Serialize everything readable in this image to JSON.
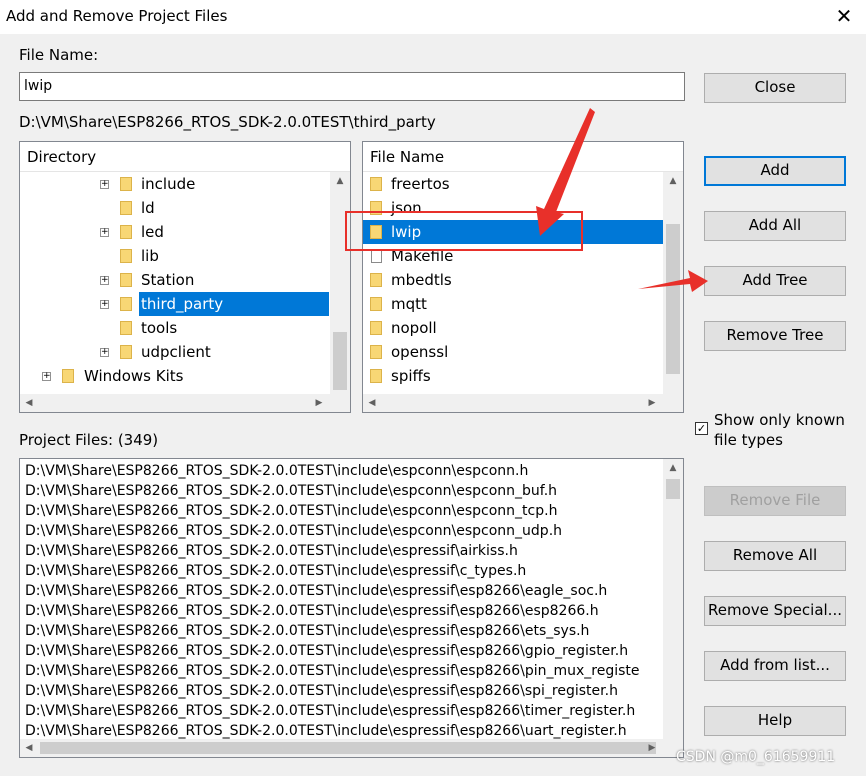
{
  "window": {
    "title": "Add and Remove Project Files",
    "close_glyph": "✕"
  },
  "file_name": {
    "label": "File Name:",
    "value": "lwip"
  },
  "current_path": "D:\\VM\\Share\\ESP8266_RTOS_SDK-2.0.0TEST\\third_party",
  "directory": {
    "header": "Directory",
    "items": [
      {
        "label": "include",
        "expand": "+"
      },
      {
        "label": "ld"
      },
      {
        "label": "led",
        "expand": "+"
      },
      {
        "label": "lib"
      },
      {
        "label": "Station",
        "expand": "+"
      },
      {
        "label": "third_party",
        "expand": "+",
        "selected": true
      },
      {
        "label": "tools"
      },
      {
        "label": "udpclient",
        "expand": "+"
      },
      {
        "label": "Windows Kits",
        "expand": "+"
      }
    ]
  },
  "files": {
    "header": "File Name",
    "items": [
      {
        "label": "freertos",
        "kind": "folder"
      },
      {
        "label": "json",
        "kind": "folder"
      },
      {
        "label": "lwip",
        "kind": "folder",
        "selected": true
      },
      {
        "label": "Makefile",
        "kind": "file"
      },
      {
        "label": "mbedtls",
        "kind": "folder"
      },
      {
        "label": "mqtt",
        "kind": "folder"
      },
      {
        "label": "nopoll",
        "kind": "folder"
      },
      {
        "label": "openssl",
        "kind": "folder"
      },
      {
        "label": "spiffs",
        "kind": "folder"
      }
    ]
  },
  "buttons": {
    "close": "Close",
    "add": "Add",
    "add_all": "Add All",
    "add_tree": "Add Tree",
    "remove_tree": "Remove Tree",
    "remove_file": "Remove File",
    "remove_all": "Remove All",
    "remove_special": "Remove Special...",
    "add_from_list": "Add from list...",
    "help": "Help"
  },
  "show_known": {
    "line1": "Show only known",
    "line2": "file types",
    "checked": true,
    "check_glyph": "✓"
  },
  "project_files": {
    "label": "Project Files: (349)",
    "items": [
      "D:\\VM\\Share\\ESP8266_RTOS_SDK-2.0.0TEST\\include\\espconn\\espconn.h",
      "D:\\VM\\Share\\ESP8266_RTOS_SDK-2.0.0TEST\\include\\espconn\\espconn_buf.h",
      "D:\\VM\\Share\\ESP8266_RTOS_SDK-2.0.0TEST\\include\\espconn\\espconn_tcp.h",
      "D:\\VM\\Share\\ESP8266_RTOS_SDK-2.0.0TEST\\include\\espconn\\espconn_udp.h",
      "D:\\VM\\Share\\ESP8266_RTOS_SDK-2.0.0TEST\\include\\espressif\\airkiss.h",
      "D:\\VM\\Share\\ESP8266_RTOS_SDK-2.0.0TEST\\include\\espressif\\c_types.h",
      "D:\\VM\\Share\\ESP8266_RTOS_SDK-2.0.0TEST\\include\\espressif\\esp8266\\eagle_soc.h",
      "D:\\VM\\Share\\ESP8266_RTOS_SDK-2.0.0TEST\\include\\espressif\\esp8266\\esp8266.h",
      "D:\\VM\\Share\\ESP8266_RTOS_SDK-2.0.0TEST\\include\\espressif\\esp8266\\ets_sys.h",
      "D:\\VM\\Share\\ESP8266_RTOS_SDK-2.0.0TEST\\include\\espressif\\esp8266\\gpio_register.h",
      "D:\\VM\\Share\\ESP8266_RTOS_SDK-2.0.0TEST\\include\\espressif\\esp8266\\pin_mux_registe",
      "D:\\VM\\Share\\ESP8266_RTOS_SDK-2.0.0TEST\\include\\espressif\\esp8266\\spi_register.h",
      "D:\\VM\\Share\\ESP8266_RTOS_SDK-2.0.0TEST\\include\\espressif\\esp8266\\timer_register.h",
      "D:\\VM\\Share\\ESP8266_RTOS_SDK-2.0.0TEST\\include\\espressif\\esp8266\\uart_register.h"
    ]
  },
  "watermark": "CSDN @m0_61659911",
  "annotation_color": "#e8302a"
}
